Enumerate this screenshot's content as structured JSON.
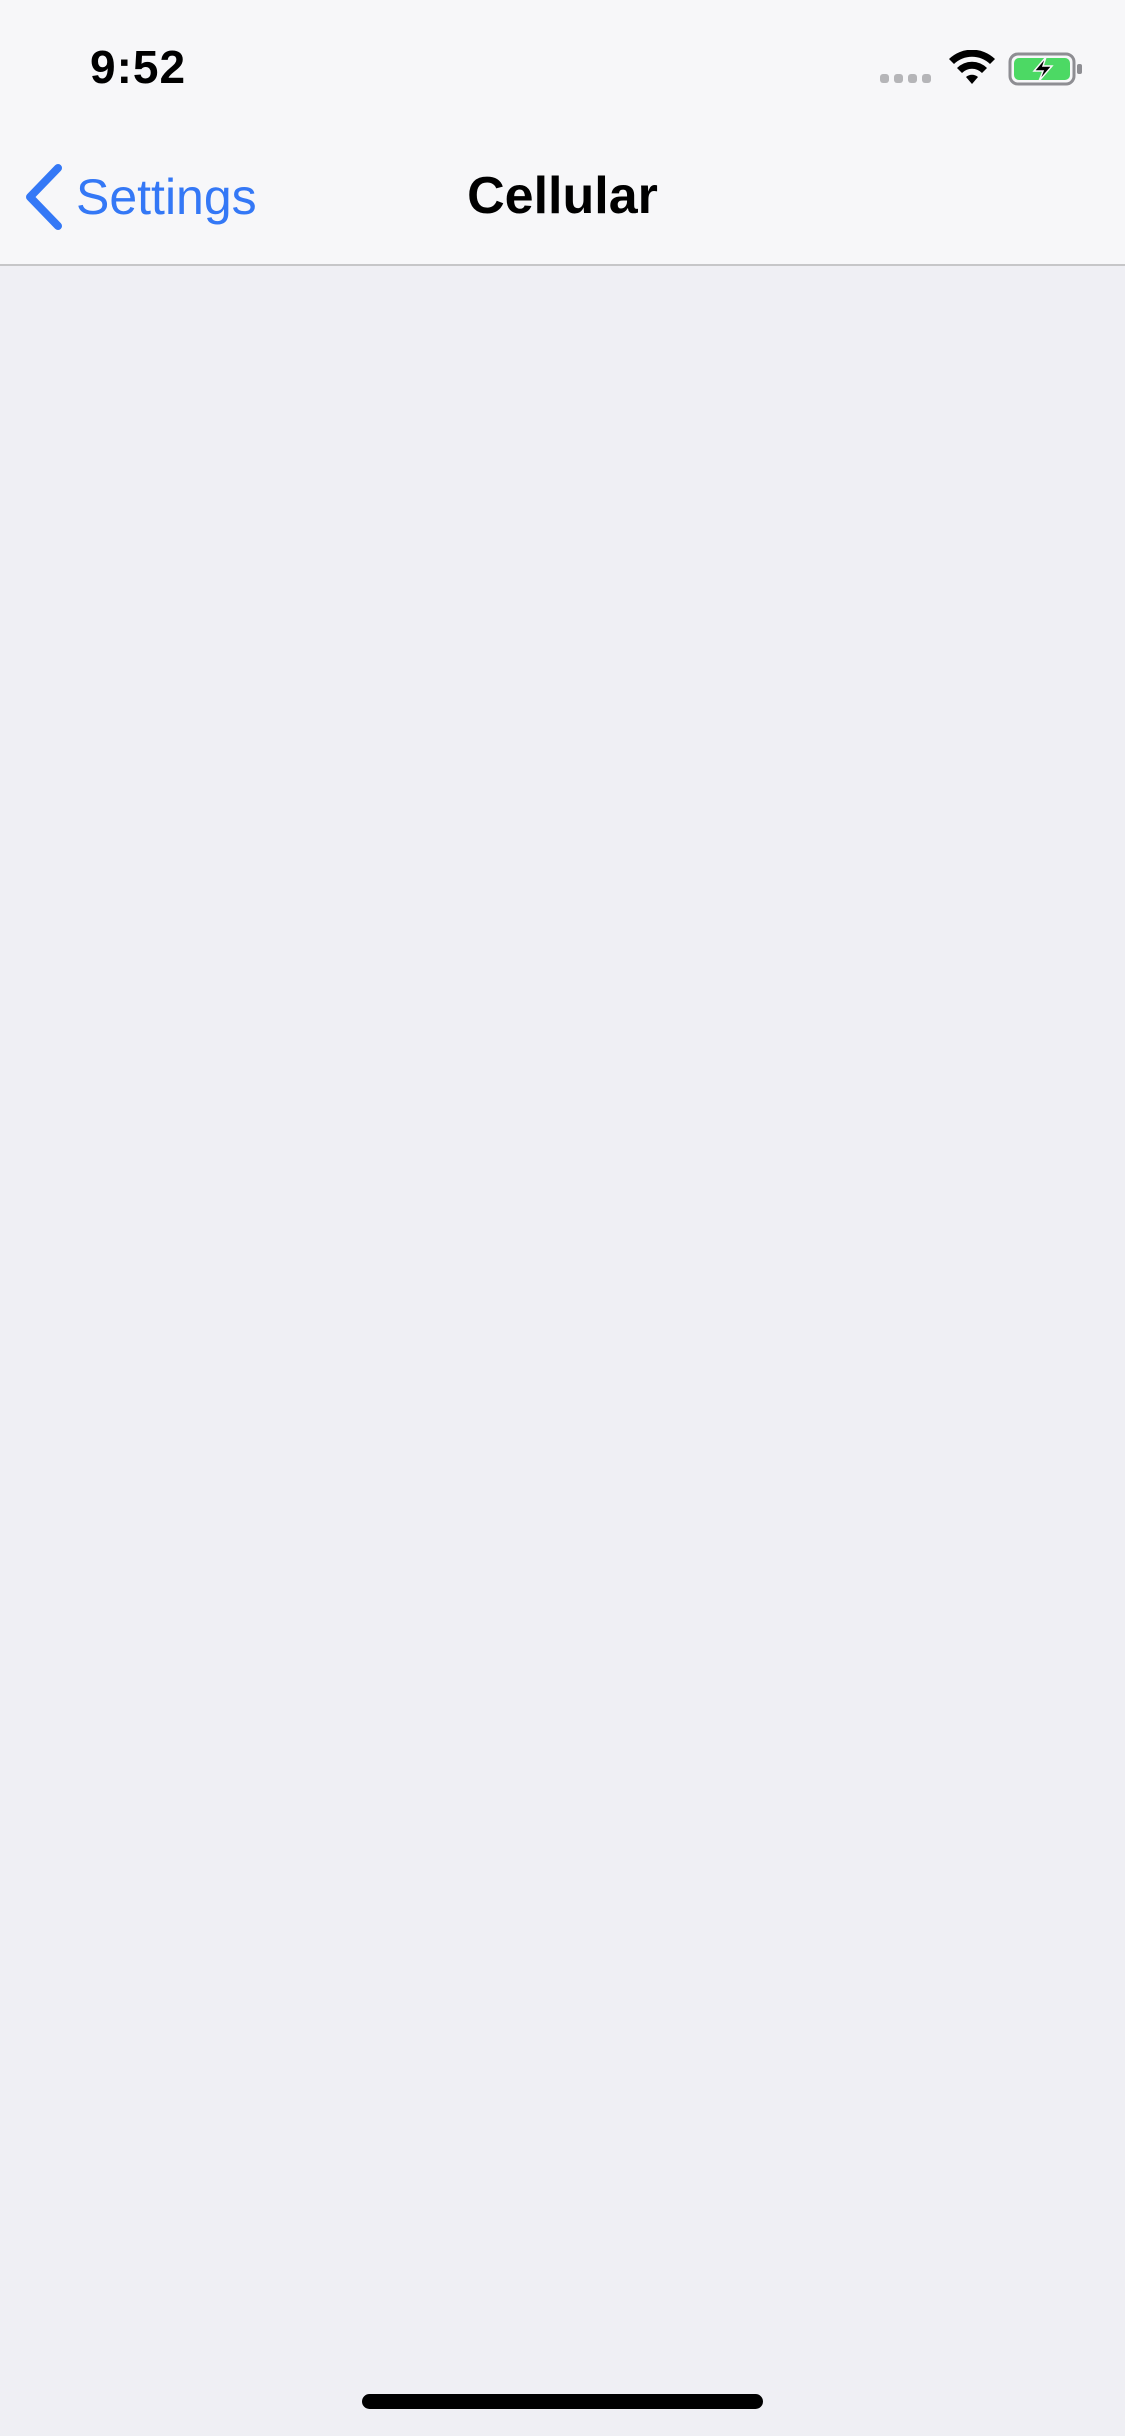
{
  "status_bar": {
    "time": "9:52",
    "icons": [
      "signal-dots-icon",
      "wifi-icon",
      "battery-charging-icon"
    ],
    "battery_color": "#4cd964"
  },
  "nav_bar": {
    "back_label": "Settings",
    "title": "Cellular"
  },
  "colors": {
    "accent": "#3478f6",
    "background": "#efeff4",
    "bar_background": "#f7f7f9"
  }
}
